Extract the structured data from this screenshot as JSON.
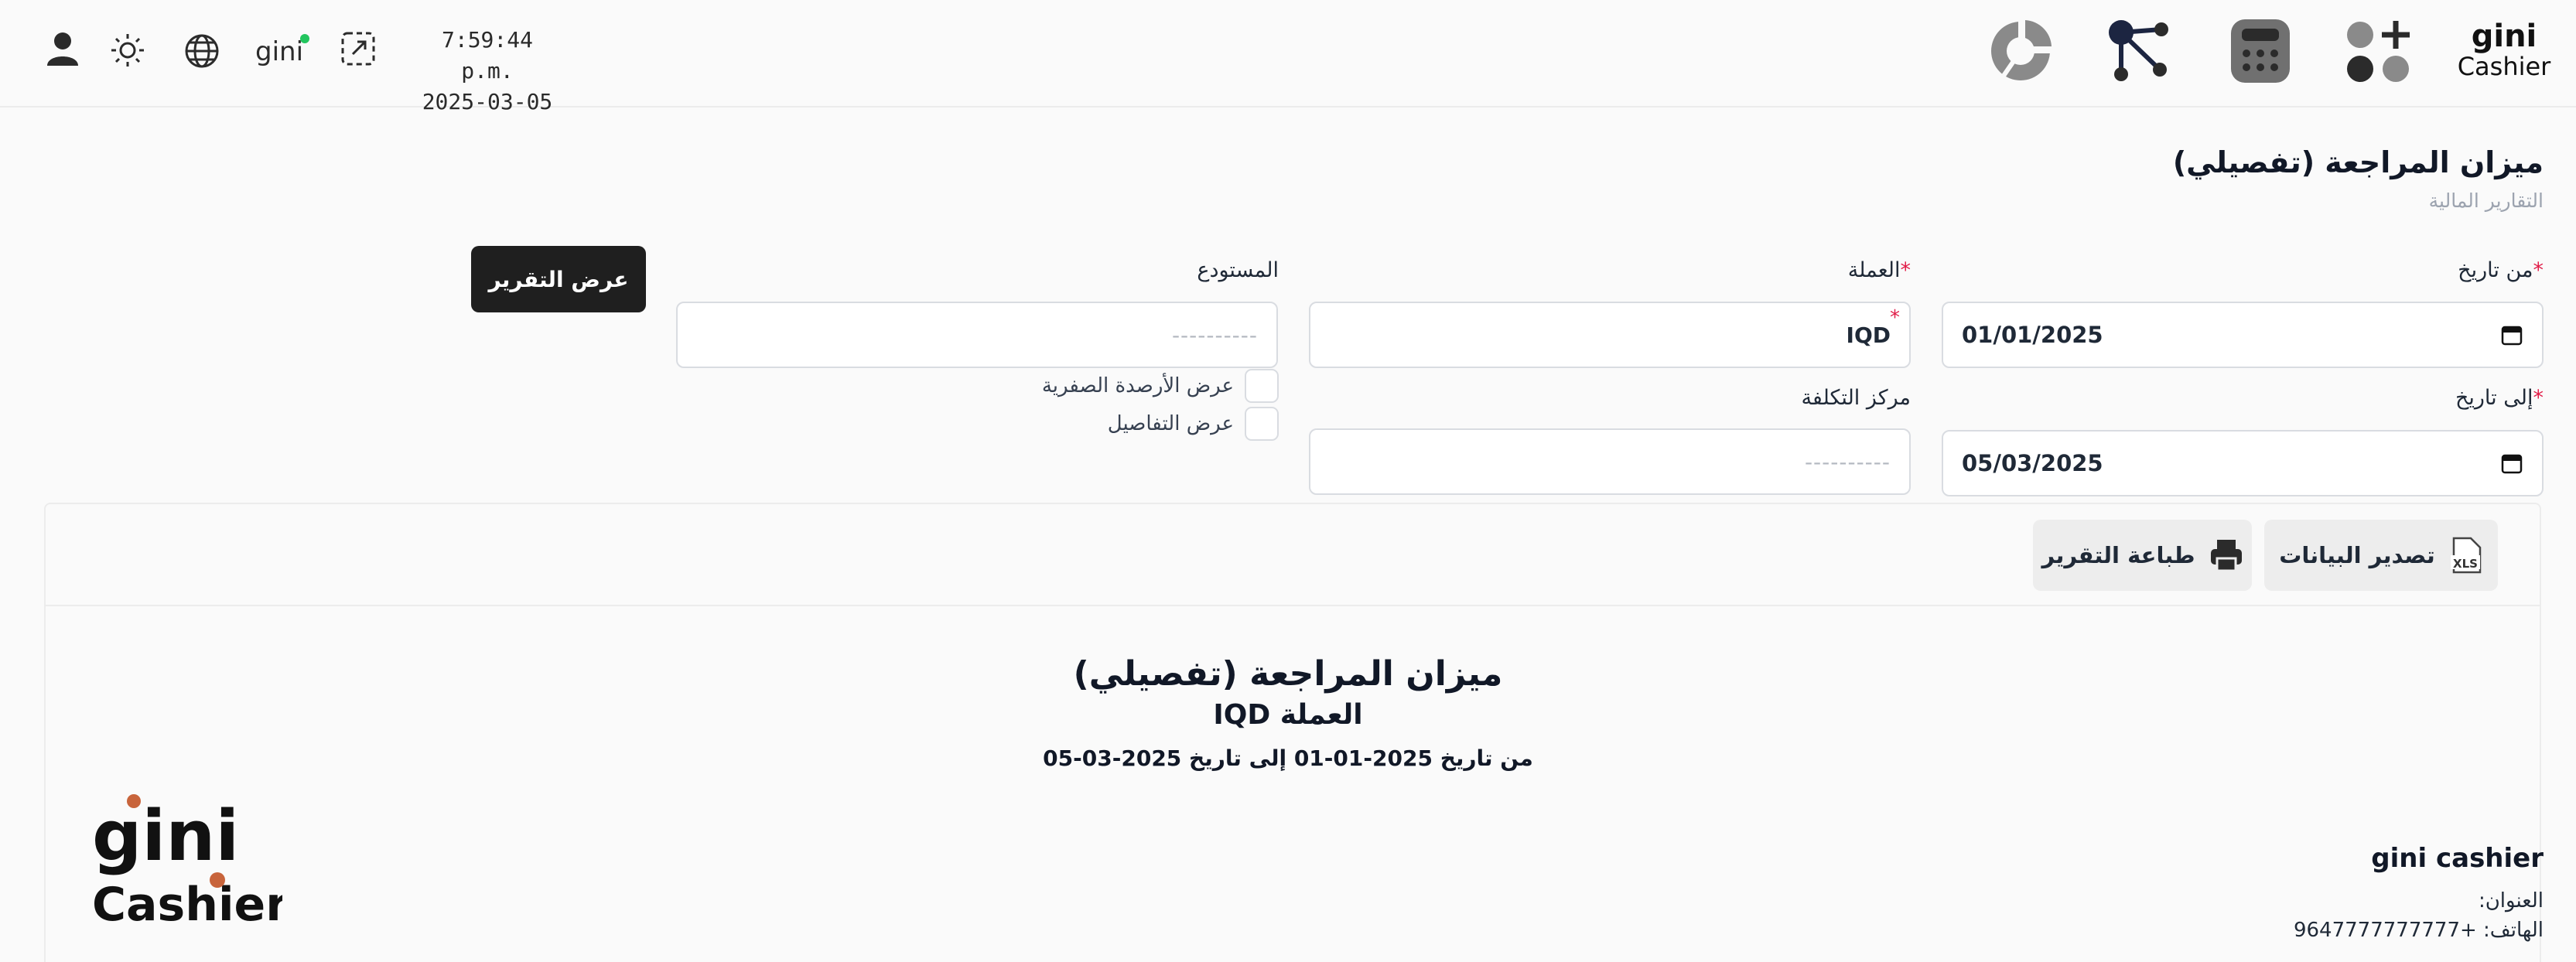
{
  "topbar": {
    "time": "7:59:44 p.m.",
    "date": "2025-03-05",
    "logo_line1": "gini",
    "logo_line2": "Cashier",
    "nav_icons": [
      "apps-add-icon",
      "calculator-icon",
      "network-nodes-icon",
      "pie-chart-icon"
    ],
    "left_icons": [
      "user-icon",
      "sun-icon",
      "globe-icon",
      "gini-status-icon",
      "fullscreen-exit-icon"
    ],
    "status_color": "#22c55e"
  },
  "page": {
    "title": "ميزان المراجعة (تفصيلي)",
    "breadcrumb": "التقارير المالية"
  },
  "form": {
    "from_date_label": "من تاريخ",
    "from_date_value": "01/01/2025",
    "to_date_label": "إلى تاريخ",
    "to_date_value": "05/03/2025",
    "currency_label": "العملة",
    "currency_value": "IQD",
    "cost_center_label": "مركز التكلفة",
    "cost_center_placeholder": "----------",
    "warehouse_label": "المستودع",
    "warehouse_placeholder": "----------",
    "show_zero_balances_label": "عرض الأرصدة الصفرية",
    "show_details_label": "عرض التفاصيل",
    "required_mark": "*",
    "show_report_button": "عرض التقرير"
  },
  "report": {
    "export_button": "تصدير البيانات",
    "export_badge": "XLS",
    "print_button": "طباعة التقرير",
    "title": "ميزان المراجعة (تفصيلي)",
    "currency_line": "العملة IQD",
    "range_line": "من تاريخ 2025-01-01 إلى تاريخ 2025-03-05",
    "company_name": "gini cashier",
    "address_label": "العنوان:",
    "phone_label": "الهاتف: +9647777777777",
    "logo_line1": "gini",
    "logo_line2": "Cashier"
  },
  "colors": {
    "accent_dark": "#1f1f1f",
    "required": "#e11d48",
    "logo_orange": "#c8643b"
  }
}
